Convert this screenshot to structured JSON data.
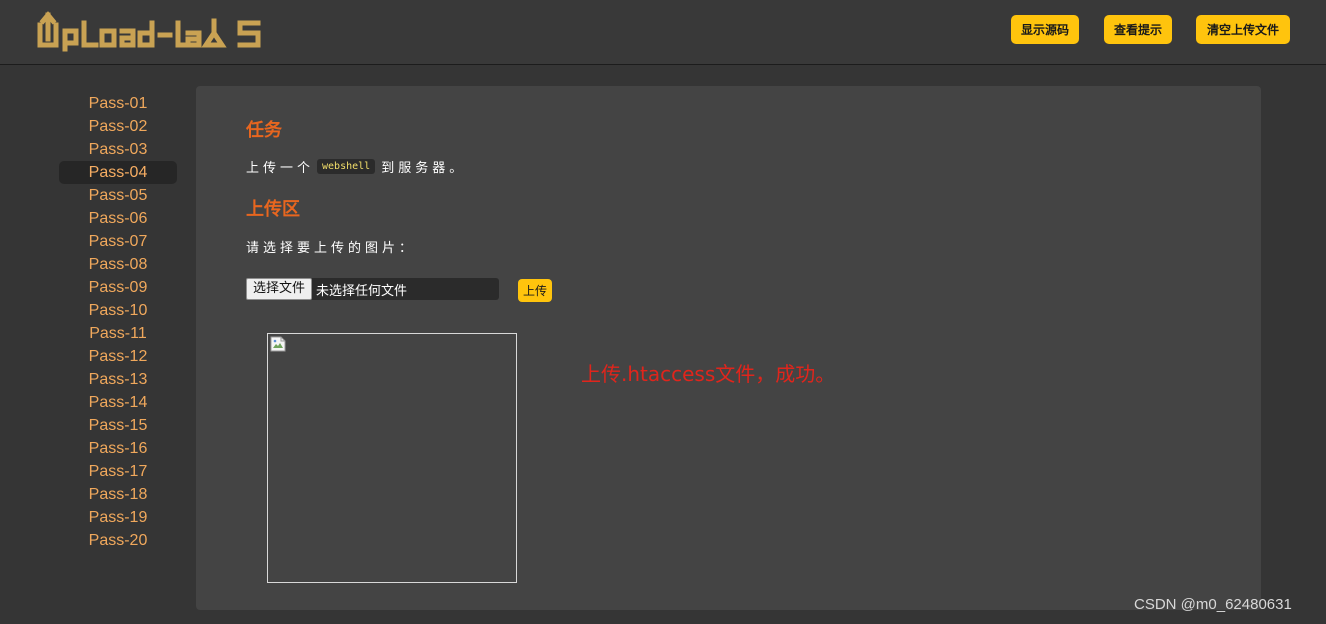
{
  "header": {
    "logo_text": "UpLoad-labs",
    "buttons": [
      "显示源码",
      "查看提示",
      "清空上传文件"
    ]
  },
  "sidebar": {
    "active_index": 3,
    "items": [
      "Pass-01",
      "Pass-02",
      "Pass-03",
      "Pass-04",
      "Pass-05",
      "Pass-06",
      "Pass-07",
      "Pass-08",
      "Pass-09",
      "Pass-10",
      "Pass-11",
      "Pass-12",
      "Pass-13",
      "Pass-14",
      "Pass-15",
      "Pass-16",
      "Pass-17",
      "Pass-18",
      "Pass-19",
      "Pass-20"
    ]
  },
  "main": {
    "task_title": "任务",
    "task_before": "上传一个",
    "task_code": "webshell",
    "task_after": "到服务器。",
    "upload_title": "上传区",
    "prompt": "请选择要上传的图片：",
    "file_button": "选择文件",
    "file_status": "未选择任何文件",
    "upload_button": "上传",
    "result_message": "上传.htaccess文件，成功。"
  },
  "watermark": "CSDN @m0_62480631",
  "colors": {
    "accent": "#ffc40d",
    "title": "#e8661f",
    "sidebar_link": "#f0a85c",
    "error": "#e0251c",
    "logo": "#c9a253"
  }
}
